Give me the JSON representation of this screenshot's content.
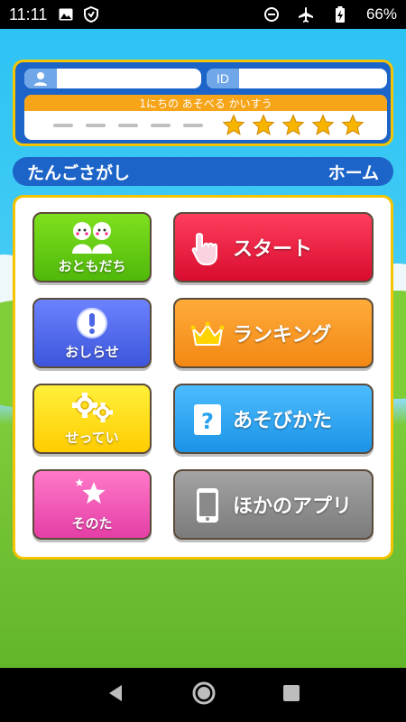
{
  "status_bar": {
    "time": "11:11",
    "battery_percent": "66%",
    "icons": [
      "image-icon",
      "shield-icon",
      "do-not-disturb-icon",
      "airplane-icon",
      "battery-charging-icon"
    ]
  },
  "profile": {
    "name_value": "",
    "id_label": "ID",
    "id_value": "",
    "plays_label": "1にちの あそべる かいすう",
    "plays_stars_total": 5,
    "plays_stars_filled": 5,
    "plays_dashes": 5
  },
  "title_bar": {
    "game_title": "たんごさがし",
    "home_label": "ホーム"
  },
  "menu": {
    "friends_label": "おともだち",
    "start_label": "スタート",
    "news_label": "おしらせ",
    "ranking_label": "ランキング",
    "settings_label": "せってい",
    "how_to_play_label": "あそびかた",
    "other_label": "そのた",
    "other_apps_label": "ほかのアプリ"
  },
  "colors": {
    "panel_blue": "#1d64c9",
    "panel_border": "#f4c400",
    "friends_green": "#62cc0e",
    "start_red": "#e8183c",
    "news_blue": "#4c66e6",
    "ranking_orange": "#f8941c",
    "settings_yellow": "#ffd600",
    "how_to_play_blue": "#27a2ef",
    "other_pink": "#ef55b3",
    "other_apps_gray": "#8a8a8a",
    "star_gold": "#f7b500"
  }
}
